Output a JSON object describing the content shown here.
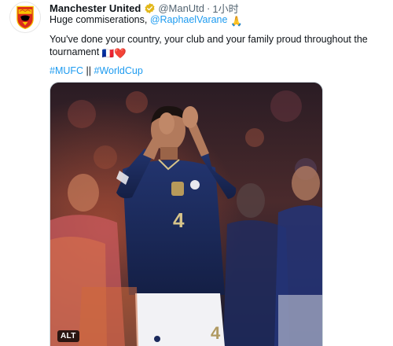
{
  "tweet": {
    "author": {
      "display_name": "Manchester United",
      "handle": "@ManUtd",
      "time": "1小时",
      "avatar_icon": "manchester-united-crest-icon",
      "verified_icon": "verified-badge-icon"
    },
    "text": {
      "line1_prefix": "Huge commiserations, ",
      "mention": "@RaphaelVarane",
      "line1_emoji": "🙏",
      "line2": "You've done your country, your club and your family proud throughout the tournament",
      "line2_emoji": "🇫🇷❤️",
      "hashtag1": "#MUFC",
      "separator": " || ",
      "hashtag2": "#WorldCup"
    },
    "media": {
      "type": "photo",
      "alt_badge": "ALT",
      "shirt_number": "4"
    }
  },
  "colors": {
    "link": "#1d9bf0",
    "secondary_text": "#536471",
    "verified_gold": "#e2b719",
    "jersey_navy": "#1b2a5c"
  }
}
